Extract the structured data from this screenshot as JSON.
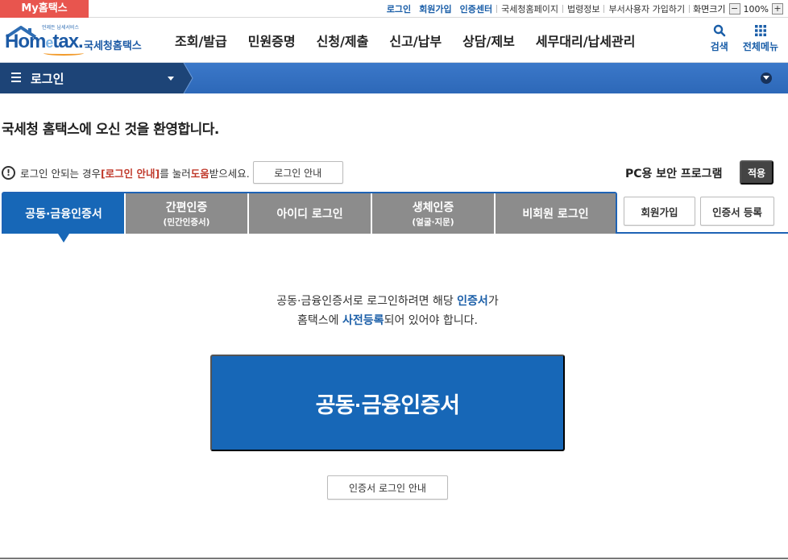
{
  "topbar": {
    "my_home": "My홈택스",
    "links": [
      {
        "label": "로그인",
        "style": "blue"
      },
      {
        "label": "회원가입",
        "style": "blue"
      },
      {
        "label": "인증센터",
        "style": "blue"
      },
      {
        "label": "국세청홈페이지",
        "style": "normal"
      },
      {
        "label": "법령정보",
        "style": "normal"
      },
      {
        "label": "부서사용자 가입하기",
        "style": "normal"
      }
    ],
    "screen_size_label": "화면크기",
    "zoom_minus": "−",
    "zoom_value": "100%",
    "zoom_plus": "+"
  },
  "header": {
    "logo_tagline": "언제든 납세서비스",
    "logo_brand_1": "Hom",
    "logo_brand_e": "e",
    "logo_brand_2": "tax.",
    "logo_org": "국세청홈택스",
    "nav": [
      "조회/발급",
      "민원증명",
      "신청/제출",
      "신고/납부",
      "상담/제보",
      "세무대리/납세관리"
    ],
    "search_label": "검색",
    "all_menu_label": "전체메뉴"
  },
  "location": {
    "current": "로그인"
  },
  "main": {
    "welcome": "국세청 홈택스에 오신 것을 환영합니다.",
    "notice_icon": "!",
    "notice_pre": "로그인 안되는 경우 ",
    "notice_link": "[로그인 안내]",
    "notice_mid": "를 눌러 ",
    "notice_help": "도움",
    "notice_post": "받으세요.",
    "login_guide_button": "로그인 안내",
    "pc_security_label": "PC용 보안 프로그램",
    "apply_button": "적용"
  },
  "tabs": [
    {
      "label": "공동·금융인증서",
      "sub": "",
      "active": true
    },
    {
      "label": "간편인증",
      "sub": "(민간인증서)",
      "active": false
    },
    {
      "label": "아이디 로그인",
      "sub": "",
      "active": false
    },
    {
      "label": "생체인증",
      "sub": "(얼굴·지문)",
      "active": false
    },
    {
      "label": "비회원 로그인",
      "sub": "",
      "active": false
    }
  ],
  "side_buttons": {
    "join": "회원가입",
    "cert_register": "인증서 등록"
  },
  "cert_panel": {
    "line1_pre": "공동·금융인증서로 로그인하려면 해당 ",
    "line1_hl": "인증서",
    "line1_post": "가",
    "line2_pre": "홈택스에 ",
    "line2_hl": "사전등록",
    "line2_post": "되어 있어야 합니다.",
    "big_button": "공동·금융인증서",
    "cert_login_guide": "인증서 로그인 안내"
  },
  "colors": {
    "primary_blue": "#1767b7",
    "tab_gray": "#8c8c8c",
    "my_home_red": "#e8554e",
    "highlight_red": "#c0392b"
  }
}
